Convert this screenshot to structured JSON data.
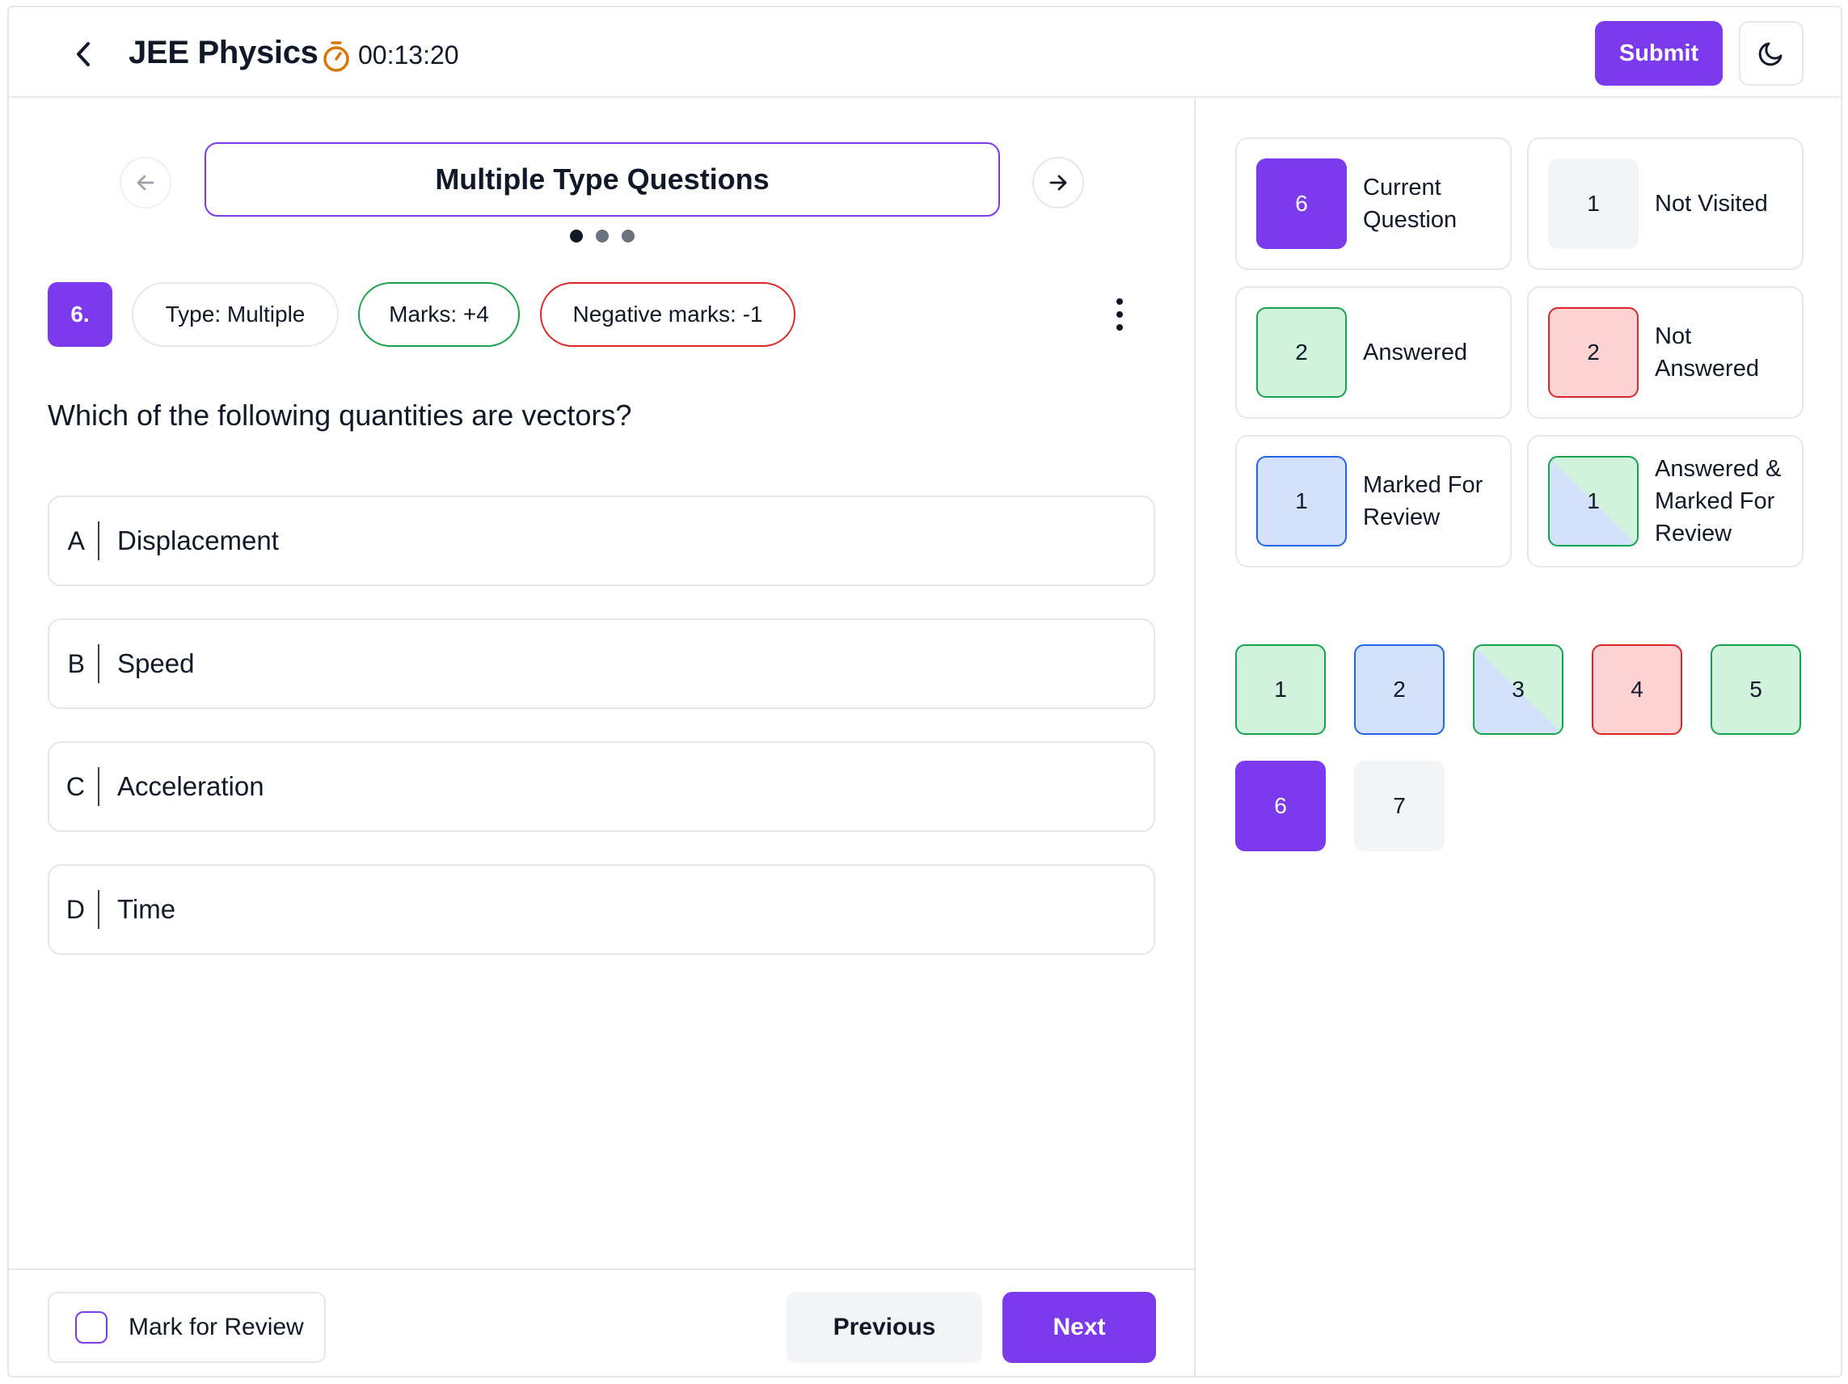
{
  "header": {
    "title": "JEE Physics",
    "timer": "00:13:20",
    "submit_label": "Submit",
    "back_icon": "chevron-left-icon",
    "timer_icon": "stopwatch-icon",
    "theme_icon": "moon-icon"
  },
  "section": {
    "title": "Multiple Type Questions",
    "dots": 3,
    "active_dot": 0
  },
  "question": {
    "number": "6.",
    "type": "Type: Multiple",
    "marks": "Marks: +4",
    "negative": "Negative marks: -1",
    "text": "Which of the following quantities are vectors?",
    "options": [
      {
        "letter": "A",
        "text": "Displacement"
      },
      {
        "letter": "B",
        "text": "Speed"
      },
      {
        "letter": "C",
        "text": "Acceleration"
      },
      {
        "letter": "D",
        "text": "Time"
      }
    ]
  },
  "footer": {
    "mark_review_label": "Mark for Review",
    "previous_label": "Previous",
    "next_label": "Next"
  },
  "legend": [
    {
      "count": "6",
      "label": "Current Question",
      "status": "current"
    },
    {
      "count": "1",
      "label": "Not Visited",
      "status": "notvisited"
    },
    {
      "count": "2",
      "label": "Answered",
      "status": "answered"
    },
    {
      "count": "2",
      "label": "Not Answered",
      "status": "notanswered"
    },
    {
      "count": "1",
      "label": "Marked For Review",
      "status": "review"
    },
    {
      "count": "1",
      "label": "Answered & Marked For Review",
      "status": "ansreview"
    }
  ],
  "question_palette": [
    {
      "number": "1",
      "status": "answered"
    },
    {
      "number": "2",
      "status": "review"
    },
    {
      "number": "3",
      "status": "ansreview"
    },
    {
      "number": "4",
      "status": "notanswered"
    },
    {
      "number": "5",
      "status": "answered"
    },
    {
      "number": "6",
      "status": "current"
    },
    {
      "number": "7",
      "status": "notvisited"
    }
  ],
  "colors": {
    "accent": "#7c3aed",
    "answered": "#16a34a",
    "not_answered": "#dc2626",
    "review": "#2563eb",
    "timer": "#d97706"
  }
}
